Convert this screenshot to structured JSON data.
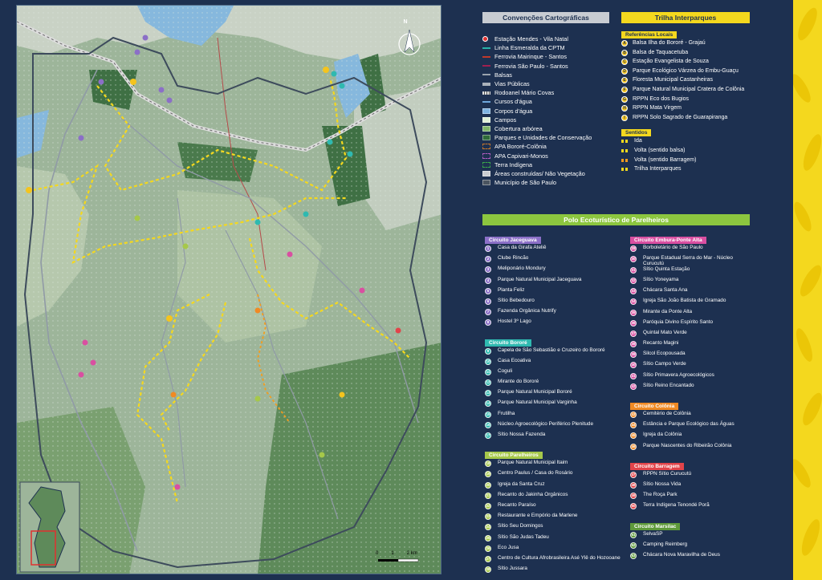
{
  "map": {
    "north_label": "N",
    "scale": {
      "labels": [
        "0",
        "1",
        "2 km"
      ]
    }
  },
  "legend": {
    "title": "Convenções Cartográficas",
    "items": [
      {
        "label": "Estação Mendes - Vila Natal",
        "symbol": "station",
        "color": "#e03030"
      },
      {
        "label": "Linha Esmeralda da CPTM",
        "symbol": "line",
        "color": "#27b3a7"
      },
      {
        "label": "Ferrovia Mairinque - Santos",
        "symbol": "line",
        "color": "#c0392b"
      },
      {
        "label": "Ferrovia São Paulo - Santos",
        "symbol": "line",
        "color": "#a02050"
      },
      {
        "label": "Balsas",
        "symbol": "line",
        "color": "#9aa3ad"
      },
      {
        "label": "Vias Públicas",
        "symbol": "thickline",
        "color": "#aab2bb"
      },
      {
        "label": "Rodoanel Mário Covas",
        "symbol": "road",
        "color": "#dddddd"
      },
      {
        "label": "Cursos d'água",
        "symbol": "line",
        "color": "#6fa8dc"
      },
      {
        "label": "Corpos d'água",
        "symbol": "box",
        "color": "#7fb3e0"
      },
      {
        "label": "Campos",
        "symbol": "box",
        "color": "#dff0d6"
      },
      {
        "label": "Cobertura arbórea",
        "symbol": "box",
        "color": "#7fb56a"
      },
      {
        "label": "Parques e Unidades de Conservação",
        "symbol": "box",
        "color": "#2f6b3a"
      },
      {
        "label": "APA Bororé-Colônia",
        "symbol": "dashbox",
        "color": "#c9782b"
      },
      {
        "label": "APA Capivari-Monos",
        "symbol": "dashbox",
        "color": "#b05cc0"
      },
      {
        "label": "Terra Indígena",
        "symbol": "dashbox",
        "color": "#3aa84a"
      },
      {
        "label": "Áreas construídas/ Não Vegetação",
        "symbol": "box",
        "color": "#c9ccd0"
      },
      {
        "label": "Município de São Paulo",
        "symbol": "box",
        "color": "#4a5460"
      }
    ]
  },
  "trilha": {
    "title": "Trilha Interparques",
    "refs_title": "Referências Locais",
    "refs": [
      {
        "code": "A",
        "label": "Balsa Ilha do Bororé - Grajaú"
      },
      {
        "code": "B",
        "label": "Balsa de Taquacetuba"
      },
      {
        "code": "C",
        "label": "Estação Evangelista de Souza"
      },
      {
        "code": "D",
        "label": "Parque Ecológico Várzea do Embu-Guaçu"
      },
      {
        "code": "E",
        "label": "Floresta Municipal Castanheiras"
      },
      {
        "code": "F",
        "label": "Parque Natural Municipal Cratera de Colônia"
      },
      {
        "code": "G",
        "label": "RPPN Eco dos Bugios"
      },
      {
        "code": "H",
        "label": "RPPN Mata Virgem"
      },
      {
        "code": "I",
        "label": "RPPN Solo Sagrado de Guarapiranga"
      }
    ],
    "sentidos_title": "Sentidos",
    "sentidos": [
      {
        "label": "Ida",
        "color": "#f4d81e"
      },
      {
        "label": "Volta (sentido balsa)",
        "color": "#f4d81e"
      },
      {
        "label": "Volta (sentido Barragem)",
        "color": "#f39c1e"
      },
      {
        "label": "Trilha Interparques",
        "color": "#f4d81e"
      }
    ]
  },
  "polo": {
    "title": "Polo Ecoturístico de Parelheiros",
    "left": [
      {
        "name": "Circuito Jaceguava",
        "color": "#8b6fc7",
        "items": [
          {
            "n": "1",
            "label": "Casa da Girafa Ateliê"
          },
          {
            "n": "2",
            "label": "Clube Rincão"
          },
          {
            "n": "3",
            "label": "Meliponário Mondury"
          },
          {
            "n": "4",
            "label": "Parque Natural Municipal Jaceguava"
          },
          {
            "n": "5",
            "label": "Planta Feliz"
          },
          {
            "n": "6",
            "label": "Sítio Bebedouro"
          },
          {
            "n": "7",
            "label": "Fazenda Orgânica Nutrify"
          },
          {
            "n": "8",
            "label": "Hostel 3º Lago"
          }
        ]
      },
      {
        "name": "Circuito Bororé",
        "color": "#2fb9b0",
        "items": [
          {
            "n": "9",
            "label": "Capela de São Sebastião e Cruzeiro do Bororé"
          },
          {
            "n": "10",
            "label": "Casa Ecoativa"
          },
          {
            "n": "11",
            "label": "Coguli"
          },
          {
            "n": "12",
            "label": "Mirante do Bororé"
          },
          {
            "n": "13",
            "label": "Parque Natural Municipal Bororé"
          },
          {
            "n": "14",
            "label": "Parque Natural Municipal Varginha"
          },
          {
            "n": "15",
            "label": "Frutilha"
          },
          {
            "n": "16",
            "label": "Núcleo Agroecológico Periférico Plenitude"
          },
          {
            "n": "17",
            "label": "Sítio Nossa Fazenda"
          }
        ]
      },
      {
        "name": "Circuito Parelheiros",
        "color": "#a6c84a",
        "items": [
          {
            "n": "18",
            "label": "Parque Natural Municipal Itaim"
          },
          {
            "n": "19",
            "label": "Centro Paulus / Casa do Rosário"
          },
          {
            "n": "20",
            "label": "Igreja da Santa Cruz"
          },
          {
            "n": "21",
            "label": "Recanto do Jakinha Orgânicos"
          },
          {
            "n": "22",
            "label": "Recanto Paraíso"
          },
          {
            "n": "23",
            "label": "Restaurante e Empório da Marlene"
          },
          {
            "n": "24",
            "label": "Sítio Seu Domingos"
          },
          {
            "n": "25",
            "label": "Sítio São Judas Tadeu"
          },
          {
            "n": "26",
            "label": "Eco Jusa"
          },
          {
            "n": "27",
            "label": "Centro de Cultura Afrobrasileira Asé Ylê do Hozooane"
          },
          {
            "n": "28",
            "label": "Sítio Jussara"
          }
        ]
      }
    ],
    "right": [
      {
        "name": "Circuito Embura-Ponte Alta",
        "color": "#d94fa1",
        "items": [
          {
            "n": "29",
            "label": "Borboletário de São Paulo"
          },
          {
            "n": "30",
            "label": "Parque Estadual Serra do Mar - Núcleo Curucutú"
          },
          {
            "n": "31",
            "label": "Sítio Quinta Estação"
          },
          {
            "n": "32",
            "label": "Sítio Yoneyama"
          },
          {
            "n": "33",
            "label": "Chácara Santa Ana"
          },
          {
            "n": "34",
            "label": "Igreja São João Batista de Gramado"
          },
          {
            "n": "35",
            "label": "Mirante da Ponte Alta"
          },
          {
            "n": "36",
            "label": "Paróquia Divino Espírito Santo"
          },
          {
            "n": "37",
            "label": "Quintal Mato Verde"
          },
          {
            "n": "38",
            "label": "Recanto Magini"
          },
          {
            "n": "39",
            "label": "Silcol Ecopousada"
          },
          {
            "n": "40",
            "label": "Sítio Campo Verde"
          },
          {
            "n": "41",
            "label": "Sítio Primavera Agroecológicos"
          },
          {
            "n": "42",
            "label": "Sítio Reino Encantado"
          }
        ]
      },
      {
        "name": "Circuito Colônia",
        "color": "#f08a24",
        "items": [
          {
            "n": "43",
            "label": "Cemitério de Colônia"
          },
          {
            "n": "44",
            "label": "Estância e Parque Ecológico das Águas"
          },
          {
            "n": "45",
            "label": "Igreja da Colônia"
          },
          {
            "n": "46",
            "label": "Parque Nascentes do Ribeirão Colônia"
          }
        ]
      },
      {
        "name": "Circuito Barragem",
        "color": "#e2444a",
        "items": [
          {
            "n": "47",
            "label": "RPPN Sítio Curucutú"
          },
          {
            "n": "48",
            "label": "Sítio Nossa Vida"
          },
          {
            "n": "49",
            "label": "The Roça Park"
          },
          {
            "n": "50",
            "label": "Terra Indígena Tenondé Porã"
          }
        ]
      },
      {
        "name": "Circuito Marsilac",
        "color": "#5e9a3a",
        "items": [
          {
            "n": "51",
            "label": "SelvaSP"
          },
          {
            "n": "52",
            "label": "Camping Reimberg"
          },
          {
            "n": "53",
            "label": "Chácara Nova Maravilha de Deus"
          }
        ]
      }
    ]
  }
}
